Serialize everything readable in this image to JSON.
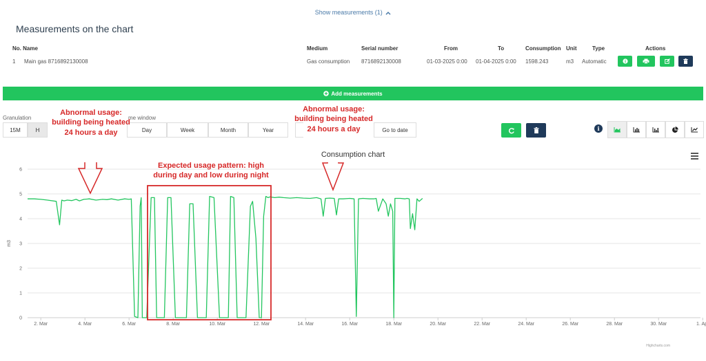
{
  "measurements": {
    "toggle_label": "Show measurements (1)",
    "toggle_icon": "chevron-up-icon",
    "title": "Measurements on the chart",
    "columns": {
      "no_name": "No. Name",
      "medium": "Medium",
      "serial": "Serial number",
      "from": "From",
      "to": "To",
      "consumption": "Consumption",
      "unit": "Unit",
      "type": "Type",
      "actions": "Actions"
    },
    "rows": [
      {
        "no": "1",
        "name": "Main gas 8716892130008",
        "medium": "Gas consumption",
        "serial": "8716892130008",
        "from": "01-03-2025 0:00",
        "to": "01-04-2025 0:00",
        "consumption": "1598.243",
        "unit": "m3",
        "type": "Automatic"
      }
    ],
    "action_icons": [
      "info-icon",
      "print-icon",
      "edit-icon",
      "trash-icon"
    ]
  },
  "add_measurements": {
    "label": "Add measurements",
    "icon": "plus-circle-icon"
  },
  "controls": {
    "granularity_label": "Granulation",
    "granularity_options": [
      "15M",
      "H"
    ],
    "granularity_selected": "H",
    "time_window_label": "me window",
    "time_window_options": [
      "Day",
      "Week",
      "Month",
      "Year"
    ],
    "go_to_date": "Go to date",
    "refresh_icon": "refresh-icon",
    "delete_icon": "trash-icon",
    "info_icon": "info-icon",
    "chart_type_icons": [
      "area-chart-icon",
      "bar-chart-icon",
      "stacked-bar-icon",
      "pie-chart-icon",
      "line-chart-icon"
    ],
    "chart_type_selected": "area-chart-icon"
  },
  "chart": {
    "menu_icon": "hamburger-menu-icon",
    "credits": "Highcharts.com"
  },
  "chart_data": {
    "type": "line",
    "title": "Consumption chart",
    "ylabel": "m3",
    "ylim": [
      0,
      6
    ],
    "yticks": [
      0,
      1,
      2,
      3,
      4,
      5,
      6
    ],
    "xlim": [
      1.4,
      31.9
    ],
    "xticks": [
      {
        "x": 2,
        "label": "2. Mar"
      },
      {
        "x": 4,
        "label": "4. Mar"
      },
      {
        "x": 6,
        "label": "6. Mar"
      },
      {
        "x": 8,
        "label": "8. Mar"
      },
      {
        "x": 10,
        "label": "10. Mar"
      },
      {
        "x": 12,
        "label": "12. Mar"
      },
      {
        "x": 14,
        "label": "14. Mar"
      },
      {
        "x": 16,
        "label": "16. Mar"
      },
      {
        "x": 18,
        "label": "18. Mar"
      },
      {
        "x": 20,
        "label": "20. Mar"
      },
      {
        "x": 22,
        "label": "22. Mar"
      },
      {
        "x": 24,
        "label": "24. Mar"
      },
      {
        "x": 26,
        "label": "26. Mar"
      },
      {
        "x": 28,
        "label": "28. Mar"
      },
      {
        "x": 30,
        "label": "30. Mar"
      },
      {
        "x": 32,
        "label": "1. Apr"
      }
    ],
    "grid": true,
    "color": "#22c55e",
    "series": [
      {
        "x": [
          1.4,
          1.7,
          2.0,
          2.3,
          2.7,
          2.85,
          2.95,
          3.05,
          3.2,
          3.4,
          3.6,
          3.75,
          3.95,
          4.2,
          4.5,
          4.8,
          5.0,
          5.2,
          5.5,
          5.8,
          6.0,
          6.1,
          6.25,
          6.4,
          6.5,
          6.55,
          6.6,
          6.7,
          6.8,
          7.0,
          7.15,
          7.25,
          7.35,
          7.45,
          7.6,
          7.75,
          7.9,
          8.1,
          8.3,
          8.5,
          8.6,
          8.75,
          8.9,
          9.1,
          9.3,
          9.5,
          9.65,
          9.85,
          10.1,
          10.3,
          10.5,
          10.6,
          10.75,
          10.9,
          11.1,
          11.3,
          11.5,
          11.6,
          11.75,
          11.9,
          12.0,
          12.1,
          12.2,
          12.3,
          12.4,
          12.6,
          12.8,
          13.0,
          13.3,
          13.6,
          13.9,
          14.2,
          14.5,
          14.7,
          14.8,
          14.9,
          15.1,
          15.3,
          15.4,
          15.5,
          15.7,
          16.0,
          16.2,
          16.3,
          16.4,
          16.6,
          16.9,
          17.0,
          17.1,
          17.2,
          17.3,
          17.5,
          17.65,
          17.75,
          17.85,
          17.95,
          18.0,
          18.05,
          18.1,
          18.3,
          18.5,
          18.6,
          18.7,
          18.75,
          18.85,
          18.95,
          19.05,
          19.15,
          19.3
        ],
        "y": [
          4.8,
          4.8,
          4.78,
          4.75,
          4.7,
          3.75,
          4.75,
          4.72,
          4.75,
          4.73,
          4.78,
          4.72,
          4.78,
          4.8,
          4.75,
          4.78,
          4.77,
          4.8,
          4.75,
          4.8,
          4.78,
          4.8,
          0.05,
          0.0,
          4.5,
          4.85,
          0.0,
          0.0,
          0.0,
          4.85,
          4.85,
          0.0,
          0.0,
          0.0,
          0.0,
          4.85,
          4.85,
          0.0,
          0.0,
          0.0,
          0.0,
          4.6,
          4.6,
          0.0,
          0.0,
          0.0,
          4.9,
          4.85,
          0.0,
          0.0,
          0.0,
          4.9,
          4.85,
          0.0,
          0.0,
          0.0,
          4.5,
          4.7,
          3.2,
          0.0,
          0.0,
          4.1,
          4.9,
          4.85,
          4.88,
          4.85,
          4.87,
          4.85,
          4.83,
          4.85,
          4.83,
          4.82,
          4.85,
          4.8,
          4.1,
          4.82,
          4.83,
          4.82,
          4.15,
          4.8,
          4.8,
          4.82,
          4.8,
          0.05,
          4.8,
          4.82,
          4.8,
          4.8,
          4.8,
          4.82,
          4.3,
          4.8,
          4.6,
          4.1,
          4.6,
          4.3,
          0.0,
          4.82,
          4.82,
          4.82,
          4.8,
          4.82,
          4.8,
          3.6,
          4.2,
          3.55,
          4.8,
          4.7,
          4.82
        ]
      }
    ],
    "annotations": [
      {
        "text": "Abnormal usage:\nbuilding being heated\n24 hours a day"
      },
      {
        "text": "Expected usage pattern: high\nduring day and low during night"
      },
      {
        "text": "Abnormal usage:\nbuilding  being heated\n24 hours a day"
      }
    ]
  }
}
